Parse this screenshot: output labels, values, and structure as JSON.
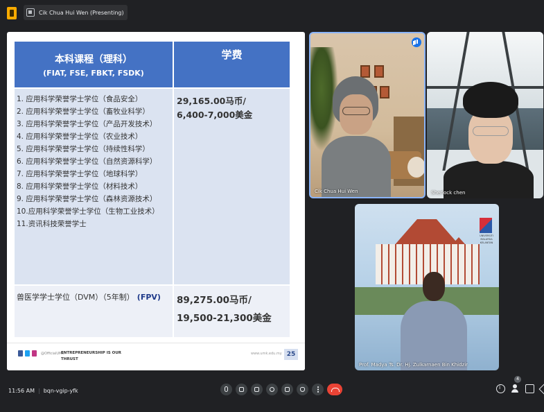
{
  "window": {
    "presenting_label": "Cik Chua Hui Wen (Presenting)"
  },
  "slide": {
    "header": {
      "col1_line1": "本科课程（理科）",
      "col1_line2": "(FIAT, FSE, FBKT, FSDK)",
      "col2": "学费"
    },
    "courses": [
      "1. 应用科学荣誉学士学位（食品安全）",
      "2. 应用科学荣誉学士学位（畜牧业科学）",
      "3. 应用科学荣誉学士学位（产品开发技术）",
      "4. 应用科学荣誉学士学位（农业技术）",
      "5. 应用科学荣誉学士学位（持续性科学）",
      "6. 应用科学荣誉学士学位（自然资源科学）",
      "7. 应用科学荣誉学士学位（地球科学）",
      "8. 应用科学荣誉学士学位（材料技术）",
      "9. 应用科学荣誉学士学位（森林资源技术）",
      "10.应用科学荣誉学士学位（生物工业技术）",
      "11.资讯科技荣誉学士"
    ],
    "fee1_line1": "29,165.00马币/",
    "fee1_line2": "6,400-7,000美金",
    "vet_course": "兽医学学士学位（DVM）（5年制）",
    "vet_faculty": "(FPV)",
    "fee2_line1": "89,275.00马币/",
    "fee2_line2": "19,500-21,300美金",
    "footer": {
      "handle": "@OfficialUMK",
      "motto": "ENTREPRENEURSHIP IS OUR THRUST",
      "url": "www.umk.edu.my",
      "page": "25"
    }
  },
  "participants": [
    {
      "name": "Cik Chua Hui Wen"
    },
    {
      "name": "Sherlock chen"
    },
    {
      "name": "Prof. Madya Ts. Dr. Hj. Zulkarnaen Bin Khidzir"
    }
  ],
  "bottom_bar": {
    "time": "11:56 AM",
    "meeting_code": "bqn-vgip-yfk",
    "people_count": "4"
  },
  "uni_logo_text": "UNIVERSITI MALAYSIA KELANTAN"
}
